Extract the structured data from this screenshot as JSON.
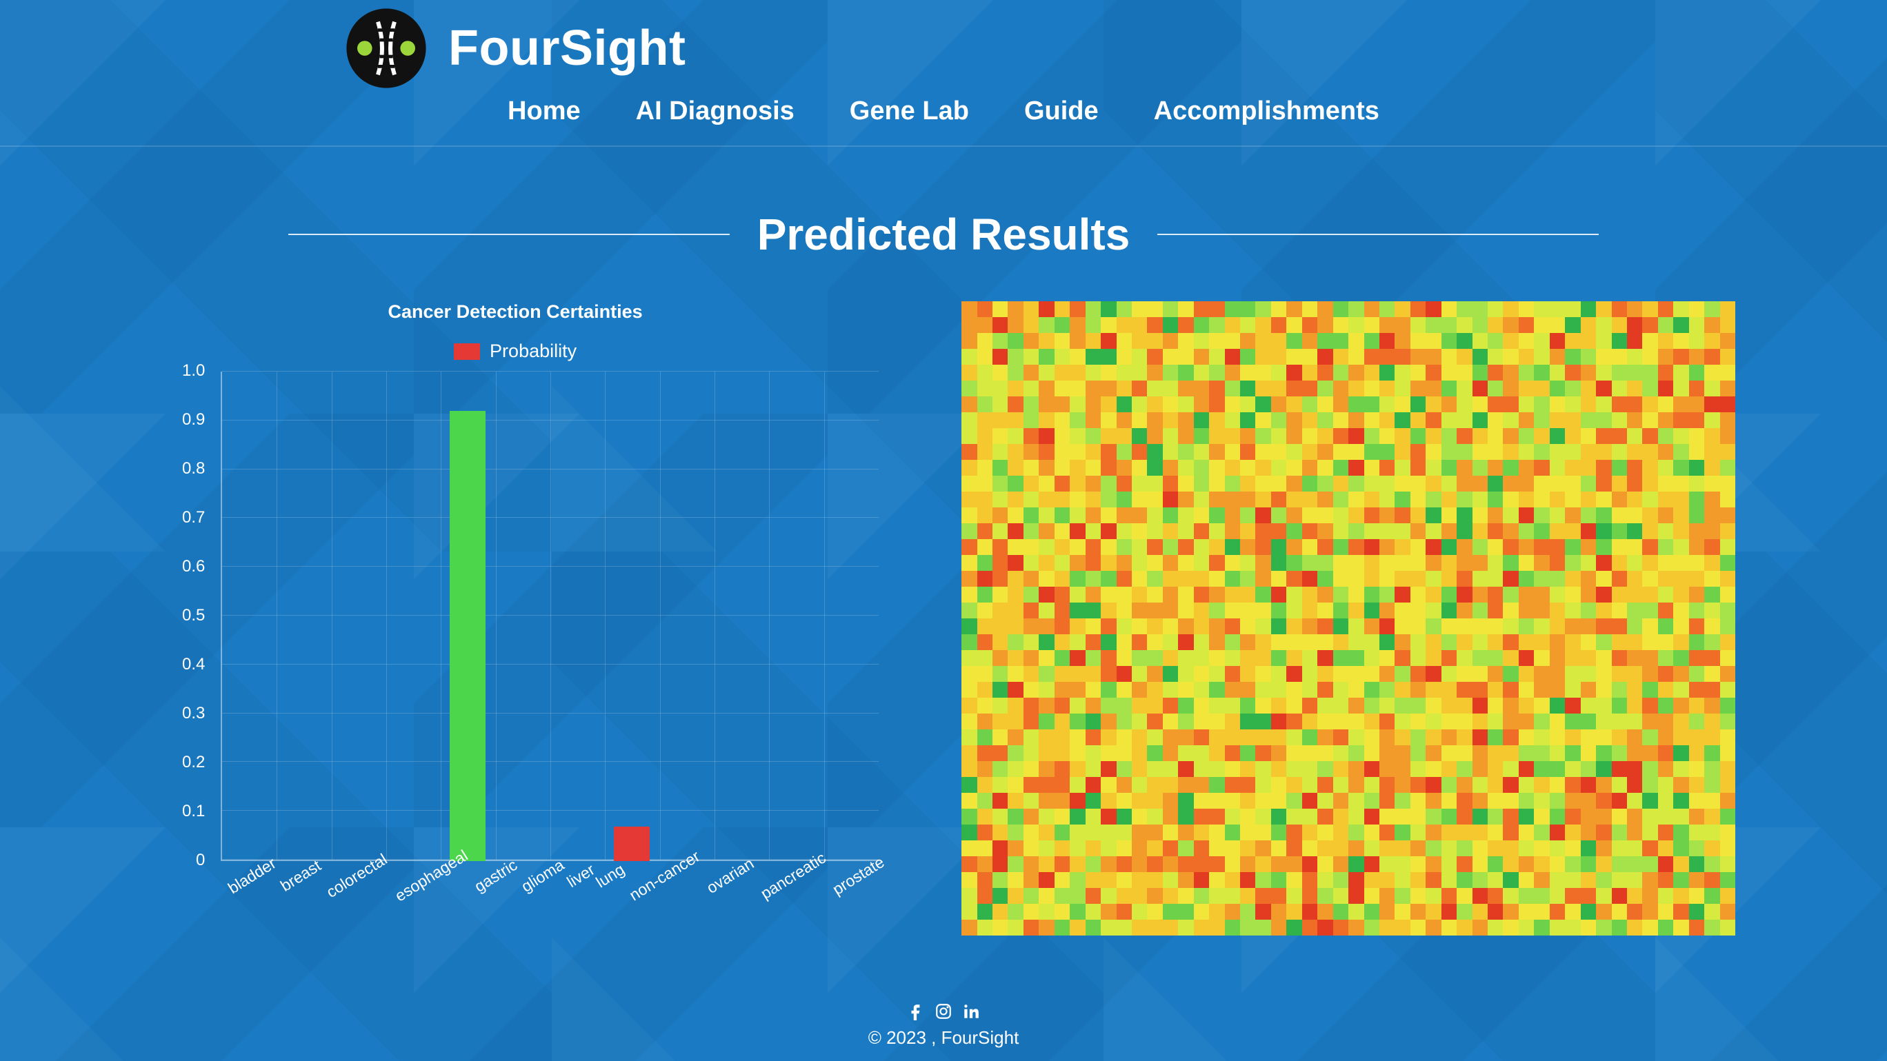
{
  "brand": "FourSight",
  "nav": {
    "home": "Home",
    "ai": "AI Diagnosis",
    "gene": "Gene Lab",
    "guide": "Guide",
    "accomp": "Accomplishments"
  },
  "page_title": "Predicted Results",
  "chart_data": {
    "type": "bar",
    "title": "Cancer Detection Certainties",
    "legend_label": "Probability",
    "ylabel": "",
    "xlabel": "",
    "ylim": [
      0,
      1.0
    ],
    "yticks": [
      "1.0",
      "0.9",
      "0.8",
      "0.7",
      "0.6",
      "0.5",
      "0.4",
      "0.3",
      "0.2",
      "0.1",
      "0"
    ],
    "categories": [
      "bladder",
      "breast",
      "colorectal",
      "esophageal",
      "gastric",
      "glioma",
      "liver",
      "lung",
      "non-cancer",
      "ovarian",
      "pancreatic",
      "prostate"
    ],
    "values": [
      0,
      0,
      0,
      0,
      0.92,
      0,
      0,
      0.07,
      0,
      0,
      0,
      0
    ],
    "highlight_index": 4,
    "bar_color": "#e53935",
    "highlight_color": "#4cd64c"
  },
  "heatmap": {
    "rows": 40,
    "cols": 50,
    "palette": [
      "#2fb34a",
      "#6dd24a",
      "#a6e24a",
      "#d6ea3f",
      "#f2e63a",
      "#f6c830",
      "#f39b2a",
      "#ef6d26",
      "#e23b21"
    ]
  },
  "footer": {
    "copyright": "© 2023 , FourSight"
  }
}
